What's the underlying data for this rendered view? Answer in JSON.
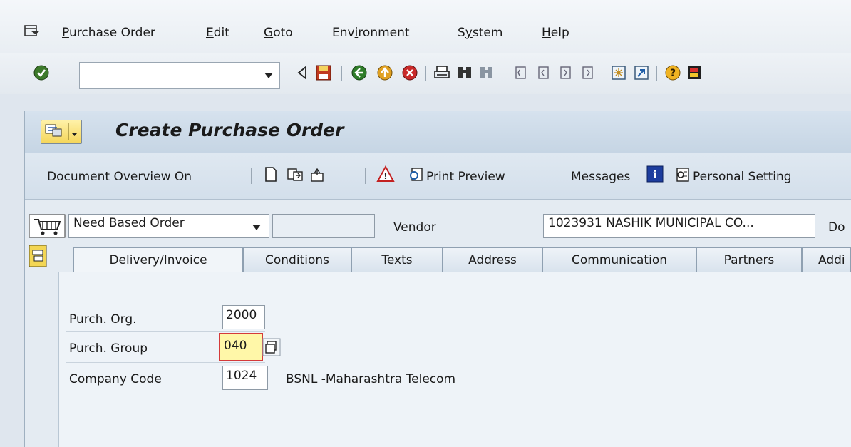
{
  "menubar": {
    "items": [
      {
        "label": "Purchase Order",
        "accel": "P",
        "rest": "urchase Order"
      },
      {
        "label": "Edit",
        "accel": "E",
        "rest": "dit"
      },
      {
        "label": "Goto",
        "accel": "G",
        "rest": "oto"
      },
      {
        "label": "Environment",
        "pre": "Env",
        "accel": "i",
        "rest": "ronment"
      },
      {
        "label": "System",
        "pre": "S",
        "accel": "y",
        "rest": "stem"
      },
      {
        "label": "Help",
        "accel": "H",
        "rest": "elp"
      }
    ]
  },
  "toolbar": {
    "command_value": ""
  },
  "title": {
    "text": "Create Purchase Order"
  },
  "app_toolbar": {
    "document_overview": "Document Overview On",
    "print_preview": "Print Preview",
    "messages": "Messages",
    "personal_setting": "Personal Setting"
  },
  "header": {
    "order_type": "Need Based Order",
    "order_number": "",
    "vendor_label": "Vendor",
    "vendor_value": "1023931 NASHIK MUNICIPAL CO...",
    "doc_date_label_partial": "Do"
  },
  "tabs": [
    {
      "label": "Delivery/Invoice"
    },
    {
      "label": "Conditions"
    },
    {
      "label": "Texts"
    },
    {
      "label": "Address"
    },
    {
      "label": "Communication"
    },
    {
      "label": "Partners"
    },
    {
      "label": "Addi"
    }
  ],
  "org_data": {
    "purch_org_label": "Purch. Org.",
    "purch_org_value": "2000",
    "purch_group_label": "Purch. Group",
    "purch_group_value": "040",
    "company_code_label": "Company Code",
    "company_code_value": "1024",
    "company_code_text": "BSNL -Maharashtra Telecom"
  },
  "colors": {
    "title_bar": "#c6d5e4",
    "highlight_field": "#fff7a8",
    "error_border": "#d43a3a"
  }
}
